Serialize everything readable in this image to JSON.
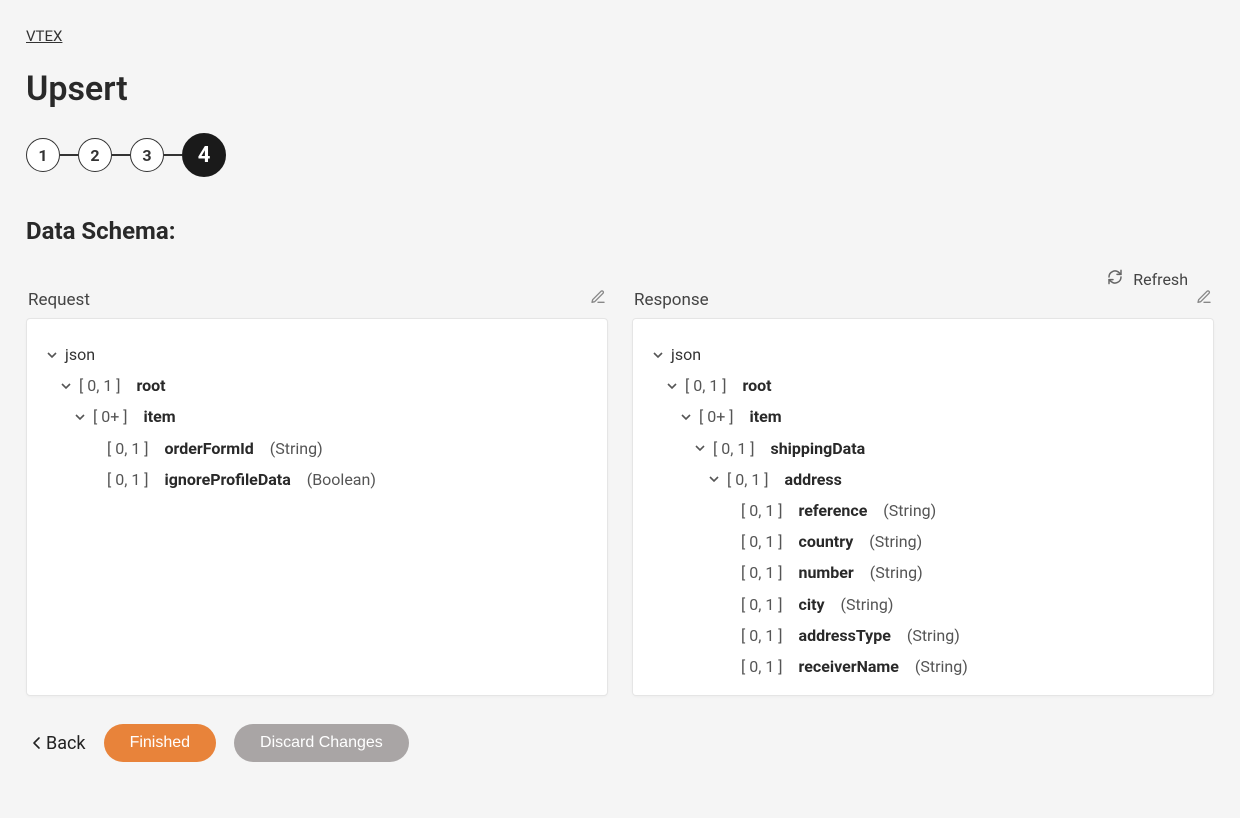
{
  "breadcrumb": {
    "label": "VTEX"
  },
  "page_title": "Upsert",
  "stepper": {
    "steps": [
      "1",
      "2",
      "3",
      "4"
    ],
    "active_index": 3
  },
  "section_title": "Data Schema:",
  "refresh_label": "Refresh",
  "panes": {
    "request": {
      "title": "Request",
      "root_label": "json",
      "tree": {
        "cardinality": "[ 0, 1 ]",
        "name": "root",
        "children": [
          {
            "cardinality": "[ 0+ ]",
            "name": "item",
            "children": [
              {
                "cardinality": "[ 0, 1 ]",
                "name": "orderFormId",
                "type": "(String)"
              },
              {
                "cardinality": "[ 0, 1 ]",
                "name": "ignoreProfileData",
                "type": "(Boolean)"
              }
            ]
          }
        ]
      }
    },
    "response": {
      "title": "Response",
      "root_label": "json",
      "tree": {
        "cardinality": "[ 0, 1 ]",
        "name": "root",
        "children": [
          {
            "cardinality": "[ 0+ ]",
            "name": "item",
            "children": [
              {
                "cardinality": "[ 0, 1 ]",
                "name": "shippingData",
                "children": [
                  {
                    "cardinality": "[ 0, 1 ]",
                    "name": "address",
                    "children": [
                      {
                        "cardinality": "[ 0, 1 ]",
                        "name": "reference",
                        "type": "(String)"
                      },
                      {
                        "cardinality": "[ 0, 1 ]",
                        "name": "country",
                        "type": "(String)"
                      },
                      {
                        "cardinality": "[ 0, 1 ]",
                        "name": "number",
                        "type": "(String)"
                      },
                      {
                        "cardinality": "[ 0, 1 ]",
                        "name": "city",
                        "type": "(String)"
                      },
                      {
                        "cardinality": "[ 0, 1 ]",
                        "name": "addressType",
                        "type": "(String)"
                      },
                      {
                        "cardinality": "[ 0, 1 ]",
                        "name": "receiverName",
                        "type": "(String)"
                      }
                    ]
                  }
                ]
              }
            ]
          }
        ]
      }
    }
  },
  "footer": {
    "back": "Back",
    "finished": "Finished",
    "discard": "Discard Changes"
  }
}
